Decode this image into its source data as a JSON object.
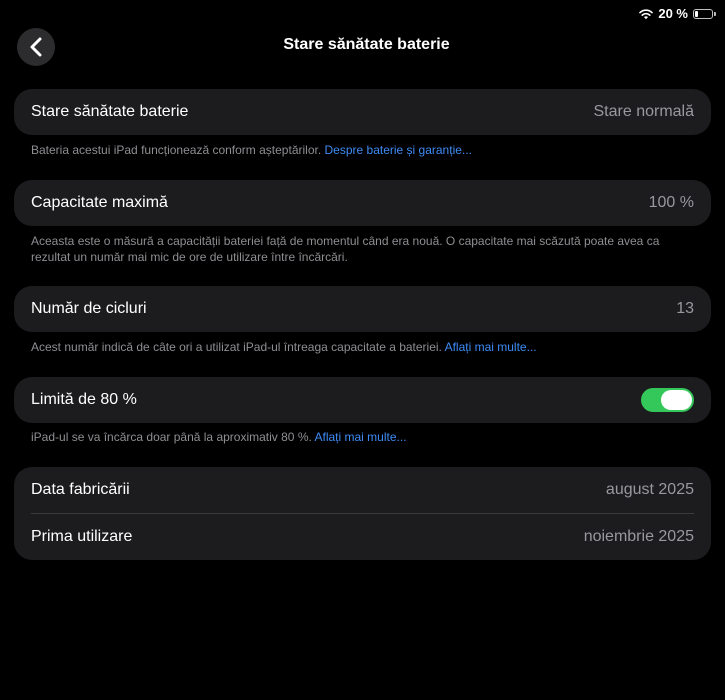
{
  "status_bar": {
    "battery_percent": "20 %",
    "battery_level": 0.2
  },
  "nav": {
    "title": "Stare sănătate baterie",
    "back_icon": "chevron-left-icon"
  },
  "health": {
    "label": "Stare sănătate baterie",
    "value": "Stare normală",
    "footer_text": "Bateria acestui iPad funcționează conform așteptărilor. ",
    "footer_link": "Despre baterie și garanție..."
  },
  "capacity": {
    "label": "Capacitate maximă",
    "value": "100 %",
    "footer_text": "Aceasta este o măsură a capacității bateriei față de momentul când era nouă. O capacitate mai scăzută poate avea ca rezultat un număr mai mic de ore de utilizare între încărcări."
  },
  "cycles": {
    "label": "Număr de cicluri",
    "value": "13",
    "footer_text": "Acest număr indică de câte ori a utilizat iPad-ul întreaga capacitate a bateriei. ",
    "footer_link": "Aflați mai multe..."
  },
  "limit": {
    "label": "Limită de 80 %",
    "toggle_on": true,
    "toggle_color": "#34c759",
    "footer_text": "iPad-ul se va încărca doar până la aproximativ 80 %. ",
    "footer_link": "Aflați mai multe..."
  },
  "dates": {
    "manufacture_label": "Data fabricării",
    "manufacture_value": "august 2025",
    "first_use_label": "Prima utilizare",
    "first_use_value": "noiembrie 2025"
  }
}
